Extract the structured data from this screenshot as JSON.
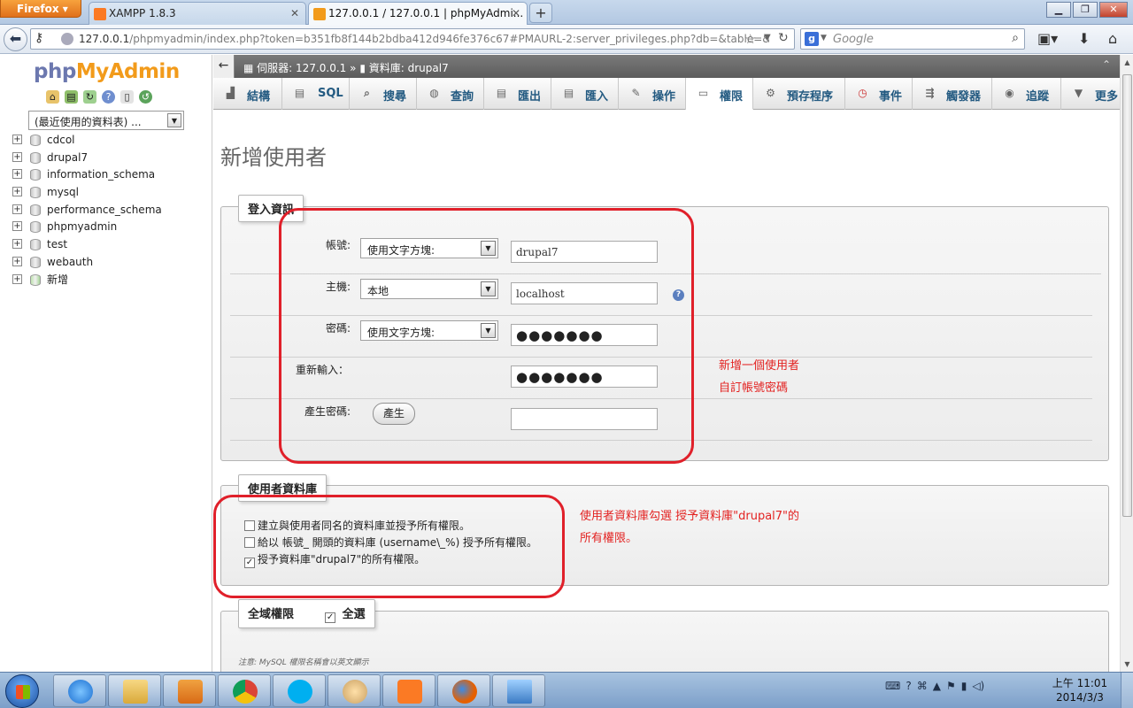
{
  "browser": {
    "button_label": "Firefox",
    "tabs": [
      {
        "title": "XAMPP 1.8.3",
        "active": false
      },
      {
        "title": "127.0.0.1 / 127.0.0.1 | phpMyAdmi...",
        "active": true
      }
    ],
    "new_tab": "+",
    "url_host": "127.0.0.1",
    "url_path": "/phpmyadmin/index.php?token=b351fb8f144b2bdba412d946fe376c67#PMAURL-2:server_privileges.php?db=&table=&s",
    "search_placeholder": "Google"
  },
  "left": {
    "logo_php": "php",
    "logo_my": "My",
    "logo_admin": "Admin",
    "recent_label": "(最近使用的資料表) ...",
    "databases": [
      "cdcol",
      "drupal7",
      "information_schema",
      "mysql",
      "performance_schema",
      "phpmyadmin",
      "test",
      "webauth",
      "新增"
    ]
  },
  "breadcrumb": {
    "server_label": "伺服器:",
    "server_value": "127.0.0.1",
    "sep": "»",
    "db_label": "資料庫:",
    "db_value": "drupal7"
  },
  "menu": [
    {
      "label": "結構",
      "icon": "structure-icon"
    },
    {
      "label": "SQL",
      "icon": "sql-icon"
    },
    {
      "label": "搜尋",
      "icon": "search-icon"
    },
    {
      "label": "查詢",
      "icon": "query-icon"
    },
    {
      "label": "匯出",
      "icon": "export-icon"
    },
    {
      "label": "匯入",
      "icon": "import-icon"
    },
    {
      "label": "操作",
      "icon": "operations-icon"
    },
    {
      "label": "權限",
      "icon": "privileges-icon"
    },
    {
      "label": "預存程序",
      "icon": "routines-icon"
    },
    {
      "label": "事件",
      "icon": "events-icon"
    },
    {
      "label": "觸發器",
      "icon": "triggers-icon"
    },
    {
      "label": "追蹤",
      "icon": "tracking-icon"
    },
    {
      "label": "更多",
      "icon": "more-icon"
    }
  ],
  "page_title": "新增使用者",
  "login": {
    "legend": "登入資訊",
    "username_label": "帳號:",
    "username_mode": "使用文字方塊:",
    "username_value": "drupal7",
    "host_label": "主機:",
    "host_mode": "本地",
    "host_value": "localhost",
    "password_label": "密碼:",
    "password_mode": "使用文字方塊:",
    "password_value": "●●●●●●●",
    "retype_label": "重新輸入：",
    "retype_value": "●●●●●●●",
    "generate_label": "產生密碼:",
    "generate_button": "產生"
  },
  "annotation1": [
    "新增一個使用者",
    "自訂帳號密碼"
  ],
  "userdb": {
    "legend": "使用者資料庫",
    "options": [
      {
        "label": "建立與使用者同名的資料庫並授予所有權限。",
        "checked": false
      },
      {
        "label": "給以 帳號_ 開頭的資料庫 (username\\_%) 授予所有權限。",
        "checked": false
      },
      {
        "label": "授予資料庫\"drupal7\"的所有權限。",
        "checked": true
      }
    ]
  },
  "annotation2": [
    "使用者資料庫勾選 授予資料庫\"drupal7\"的",
    "所有權限。"
  ],
  "global": {
    "legend": "全域權限",
    "select_all": "全選",
    "note": "注意: MySQL 權限名稱會以英文顯示"
  },
  "taskbar": {
    "clock_time": "上午 11:01",
    "clock_date": "2014/3/3"
  }
}
